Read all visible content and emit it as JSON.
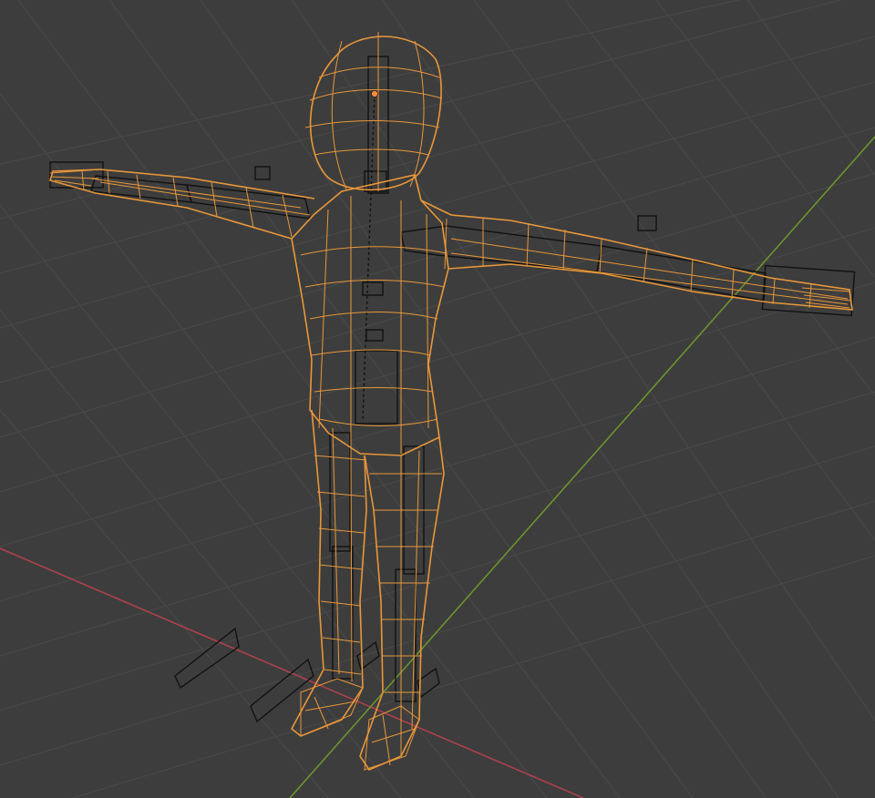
{
  "viewport": {
    "mode": "wireframe",
    "background": "#3d3d3d",
    "grid_color": "#4a4a4a",
    "x_axis_color": "#b3414d",
    "y_axis_color": "#6d9a2c",
    "mesh_color": "#e8973a",
    "armature_color": "#111111",
    "origin_color": "#ff8a3d"
  }
}
